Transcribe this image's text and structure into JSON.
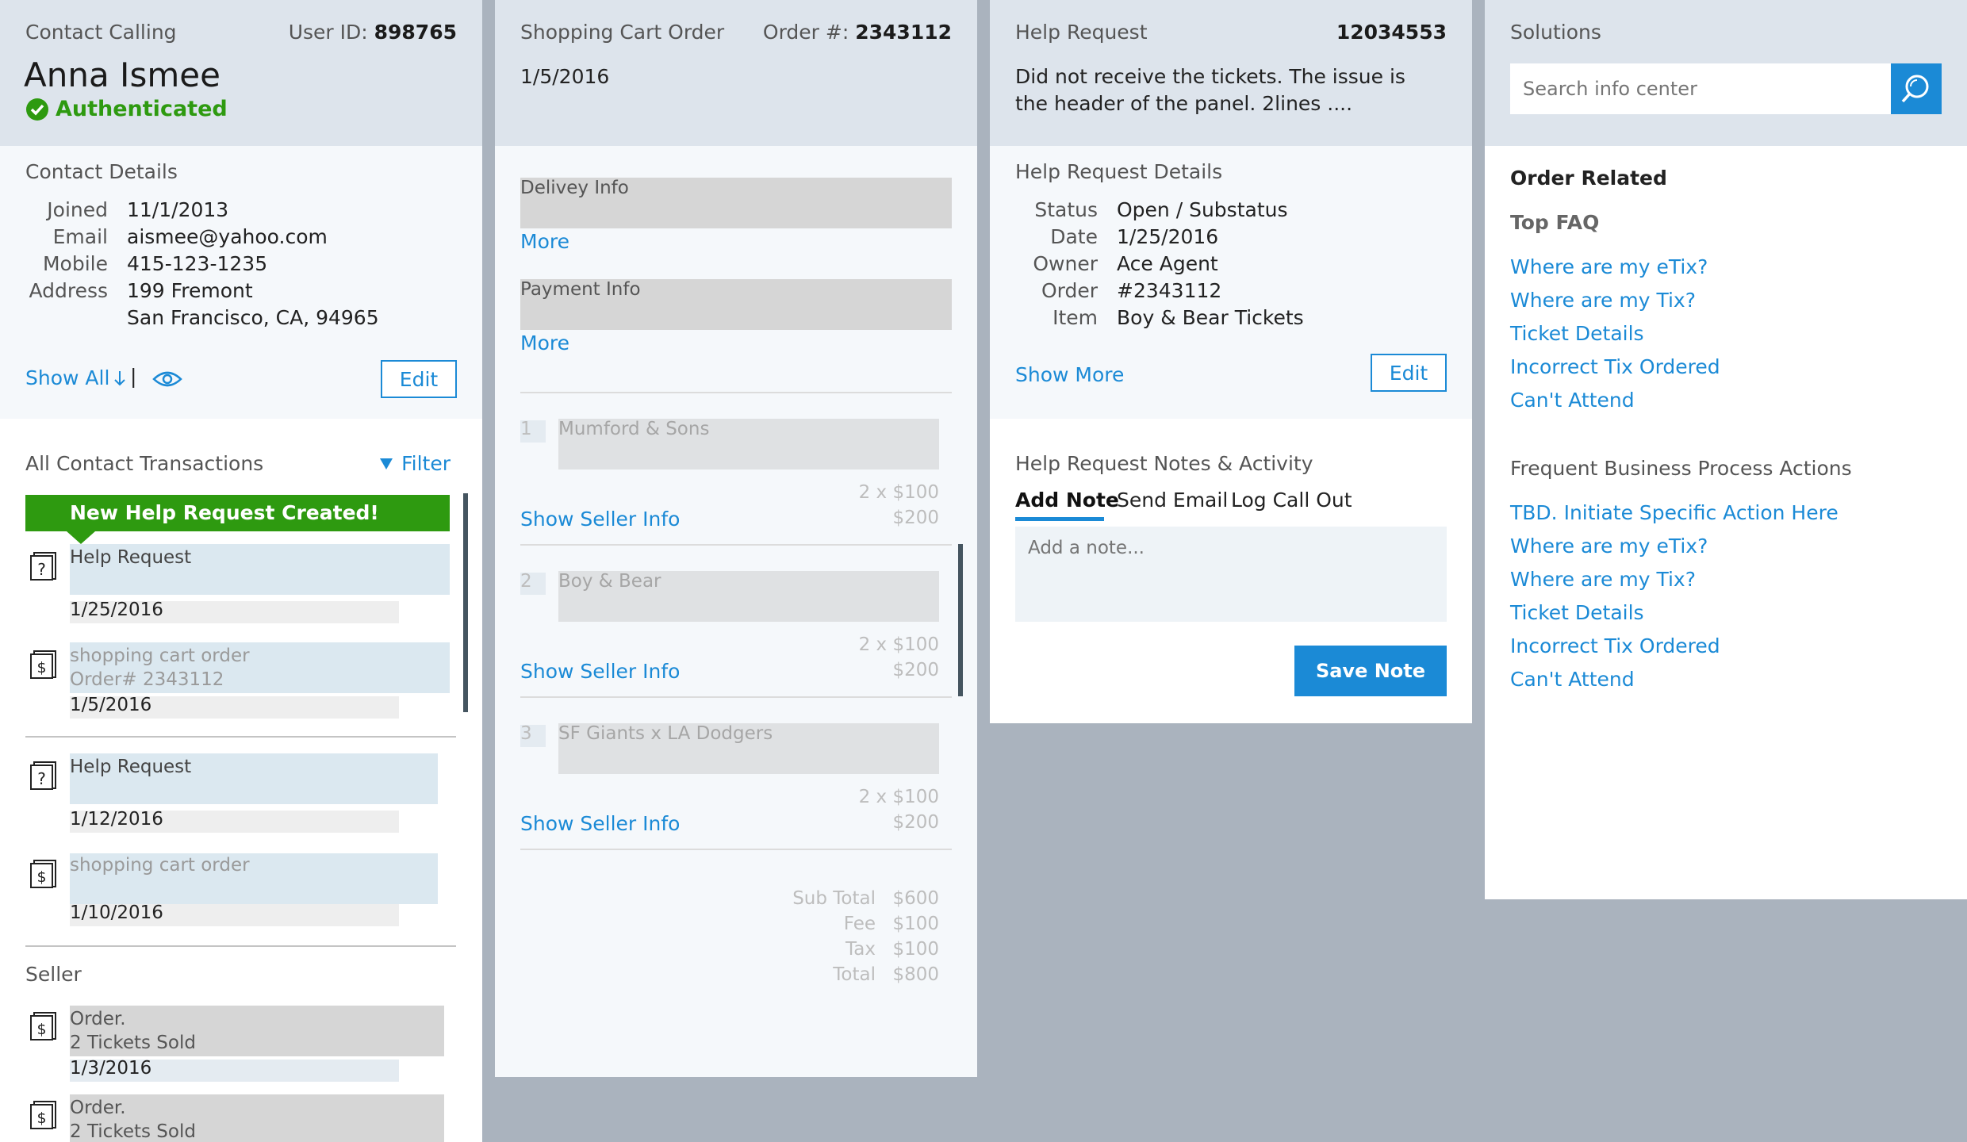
{
  "contact": {
    "header_title": "Contact Calling",
    "user_id_label": "User ID:",
    "user_id_value": "898765",
    "name": "Anna Ismee",
    "auth_status": "Authenticated",
    "details_title": "Contact Details",
    "fields": [
      {
        "label": "Joined",
        "value": "11/1/2013"
      },
      {
        "label": "Email",
        "value": "aismee@yahoo.com"
      },
      {
        "label": "Mobile",
        "value": "415-123-1235"
      },
      {
        "label": "Address",
        "value": "199 Fremont"
      }
    ],
    "address_line2": "San Francisco, CA, 94965",
    "show_all": "Show All",
    "separator": "|",
    "edit_label": "Edit",
    "transactions_title": "All Contact Transactions",
    "filter_label": "Filter",
    "banner": "New Help Request Created!",
    "transactions": [
      {
        "title": "Help Request",
        "subtitle": "",
        "date": "1/25/2016"
      },
      {
        "title": "shopping cart order",
        "subtitle": "Order# 2343112",
        "date": "1/5/2016"
      },
      {
        "title": "Help Request",
        "subtitle": "",
        "date": "1/12/2016"
      },
      {
        "title": "shopping cart order",
        "subtitle": "",
        "date": "1/10/2016"
      }
    ],
    "seller_title": "Seller",
    "seller_items": [
      {
        "title": "Order.",
        "subtitle": "2 Tickets Sold",
        "date": "1/3/2016"
      },
      {
        "title": "Order.",
        "subtitle": "2 Tickets Sold",
        "date": ""
      }
    ]
  },
  "cart": {
    "header_title": "Shopping Cart Order",
    "order_label": "Order #:",
    "order_value": "2343112",
    "date": "1/5/2016",
    "delivery_label": "Delivey Info",
    "payment_label": "Payment Info",
    "more_label": "More",
    "items": [
      {
        "num": "1",
        "name": "Mumford & Sons",
        "qty": "2 x $100",
        "price": "$200"
      },
      {
        "num": "2",
        "name": "Boy & Bear",
        "qty": "2 x $100",
        "price": "$200"
      },
      {
        "num": "3",
        "name": "SF Giants x LA Dodgers",
        "qty": "2 x $100",
        "price": "$200"
      }
    ],
    "show_seller": "Show Seller Info",
    "totals": [
      {
        "label": "Sub Total",
        "value": "$600"
      },
      {
        "label": "Fee",
        "value": "$100"
      },
      {
        "label": "Tax",
        "value": "$100"
      },
      {
        "label": "Total",
        "value": "$800"
      }
    ]
  },
  "help": {
    "header_title": "Help Request",
    "id": "12034553",
    "description_line1": "Did not receive the tickets. The issue is",
    "description_line2": "the header of the panel. 2lines ....",
    "details_title": "Help Request Details",
    "fields": [
      {
        "label": "Status",
        "value": "Open / Substatus"
      },
      {
        "label": "Date",
        "value": "1/25/2016"
      },
      {
        "label": "Owner",
        "value": "Ace Agent"
      },
      {
        "label": "Order",
        "value": "#2343112"
      },
      {
        "label": "Item",
        "value": "Boy & Bear Tickets"
      }
    ],
    "show_more": "Show More",
    "edit_label": "Edit",
    "notes_title": "Help Request Notes & Activity",
    "tabs": [
      "Add Note",
      "Send Email",
      "Log Call Out"
    ],
    "note_placeholder": "Add a note...",
    "save_label": "Save Note"
  },
  "solutions": {
    "header_title": "Solutions",
    "search_placeholder": "Search info center",
    "order_related": "Order Related",
    "top_faq": "Top FAQ",
    "faq_links": [
      "Where are my eTix?",
      "Where are my Tix?",
      "Ticket Details",
      "Incorrect Tix Ordered",
      "Can't Attend"
    ],
    "frequent_title": "Frequent Business Process Actions",
    "action_links": [
      "TBD. Initiate Specific Action Here",
      "Where are my eTix?",
      "Where are my Tix?",
      "Ticket Details",
      "Incorrect Tix Ordered",
      "Can't Attend"
    ]
  },
  "colors": {
    "accent": "#1b8ad6",
    "success": "#2e9a10",
    "header_bg": "#dde4ec",
    "backdrop": "#aab3be"
  }
}
